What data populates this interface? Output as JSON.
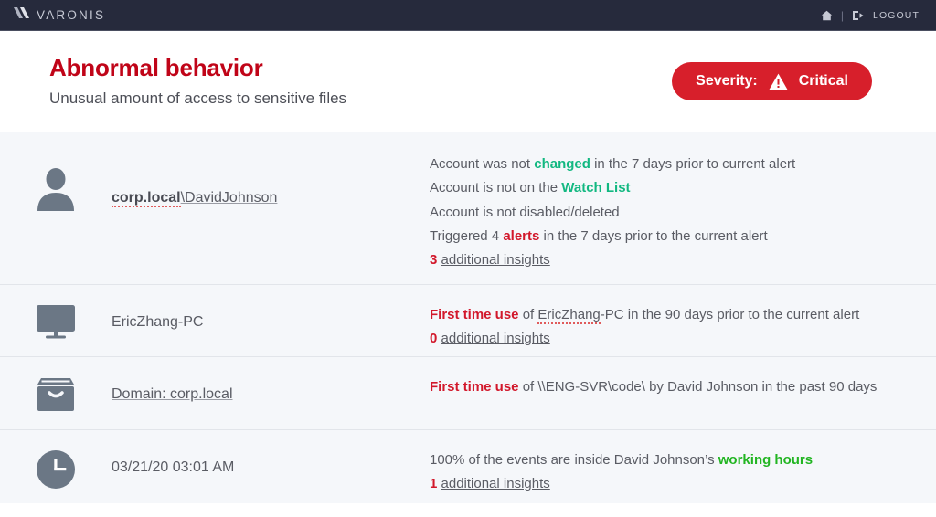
{
  "topbar": {
    "brand_name": "VARONIS",
    "brand_mark_icon": "varonis-slashes-icon",
    "home_icon": "home-icon",
    "separator": "|",
    "logout_icon": "logout-icon",
    "logout_label": "LOGOUT"
  },
  "header": {
    "title": "Abnormal behavior",
    "subtitle": "Unusual amount of access to sensitive files",
    "severity_label": "Severity:",
    "severity_value": "Critical",
    "severity_icon": "warning-triangle-icon",
    "severity_color": "#d71f2b",
    "title_color": "#c00418"
  },
  "rows": [
    {
      "icon": "user-silhouette-icon",
      "entity_prefix": "corp.local",
      "entity_suffix": "\\DavidJohnson",
      "insights": [
        {
          "parts": [
            {
              "text": "Account was not ",
              "style": "plain"
            },
            {
              "text": "changed",
              "style": "green"
            },
            {
              "text": " in the 7 days prior to current alert",
              "style": "plain"
            }
          ]
        },
        {
          "parts": [
            {
              "text": "Account is not on the ",
              "style": "plain"
            },
            {
              "text": "Watch List",
              "style": "green"
            }
          ]
        },
        {
          "parts": [
            {
              "text": "Account is not disabled/deleted",
              "style": "plain"
            }
          ]
        },
        {
          "parts": [
            {
              "text": "Triggered 4 ",
              "style": "plain"
            },
            {
              "text": "alerts",
              "style": "red"
            },
            {
              "text": " in the 7 days prior to the current alert",
              "style": "plain"
            }
          ]
        },
        {
          "parts": [
            {
              "text": "3",
              "style": "red"
            },
            {
              "text": " ",
              "style": "plain"
            },
            {
              "text": "additional insights",
              "style": "link"
            }
          ]
        }
      ]
    },
    {
      "icon": "desktop-monitor-icon",
      "entity_prefix": "",
      "entity_suffix": "EricZhang-PC",
      "insights": [
        {
          "parts": [
            {
              "text": "First time use",
              "style": "red"
            },
            {
              "text": " of ",
              "style": "plain"
            },
            {
              "text": "EricZhang",
              "style": "spell"
            },
            {
              "text": "-PC in the 90 days prior to the current alert",
              "style": "plain"
            }
          ]
        },
        {
          "parts": [
            {
              "text": "0",
              "style": "red"
            },
            {
              "text": " ",
              "style": "plain"
            },
            {
              "text": "additional insights",
              "style": "link"
            }
          ]
        }
      ]
    },
    {
      "icon": "archive-box-icon",
      "entity_prefix": "",
      "entity_suffix": "Domain: corp.local",
      "insights": [
        {
          "parts": [
            {
              "text": "First time use",
              "style": "red"
            },
            {
              "text": " of \\\\ENG-SVR\\code\\ by David Johnson in the past 90 days",
              "style": "plain"
            }
          ]
        }
      ]
    },
    {
      "icon": "clock-icon",
      "entity_prefix": "",
      "entity_suffix": "03/21/20 03:01 AM",
      "insights": [
        {
          "parts": [
            {
              "text": "100% of the events are inside David Johnson’s ",
              "style": "plain"
            },
            {
              "text": "working hours",
              "style": "green-bright"
            }
          ]
        },
        {
          "parts": [
            {
              "text": "1",
              "style": "red"
            },
            {
              "text": " ",
              "style": "plain"
            },
            {
              "text": "additional insights",
              "style": "link"
            }
          ]
        }
      ]
    }
  ]
}
